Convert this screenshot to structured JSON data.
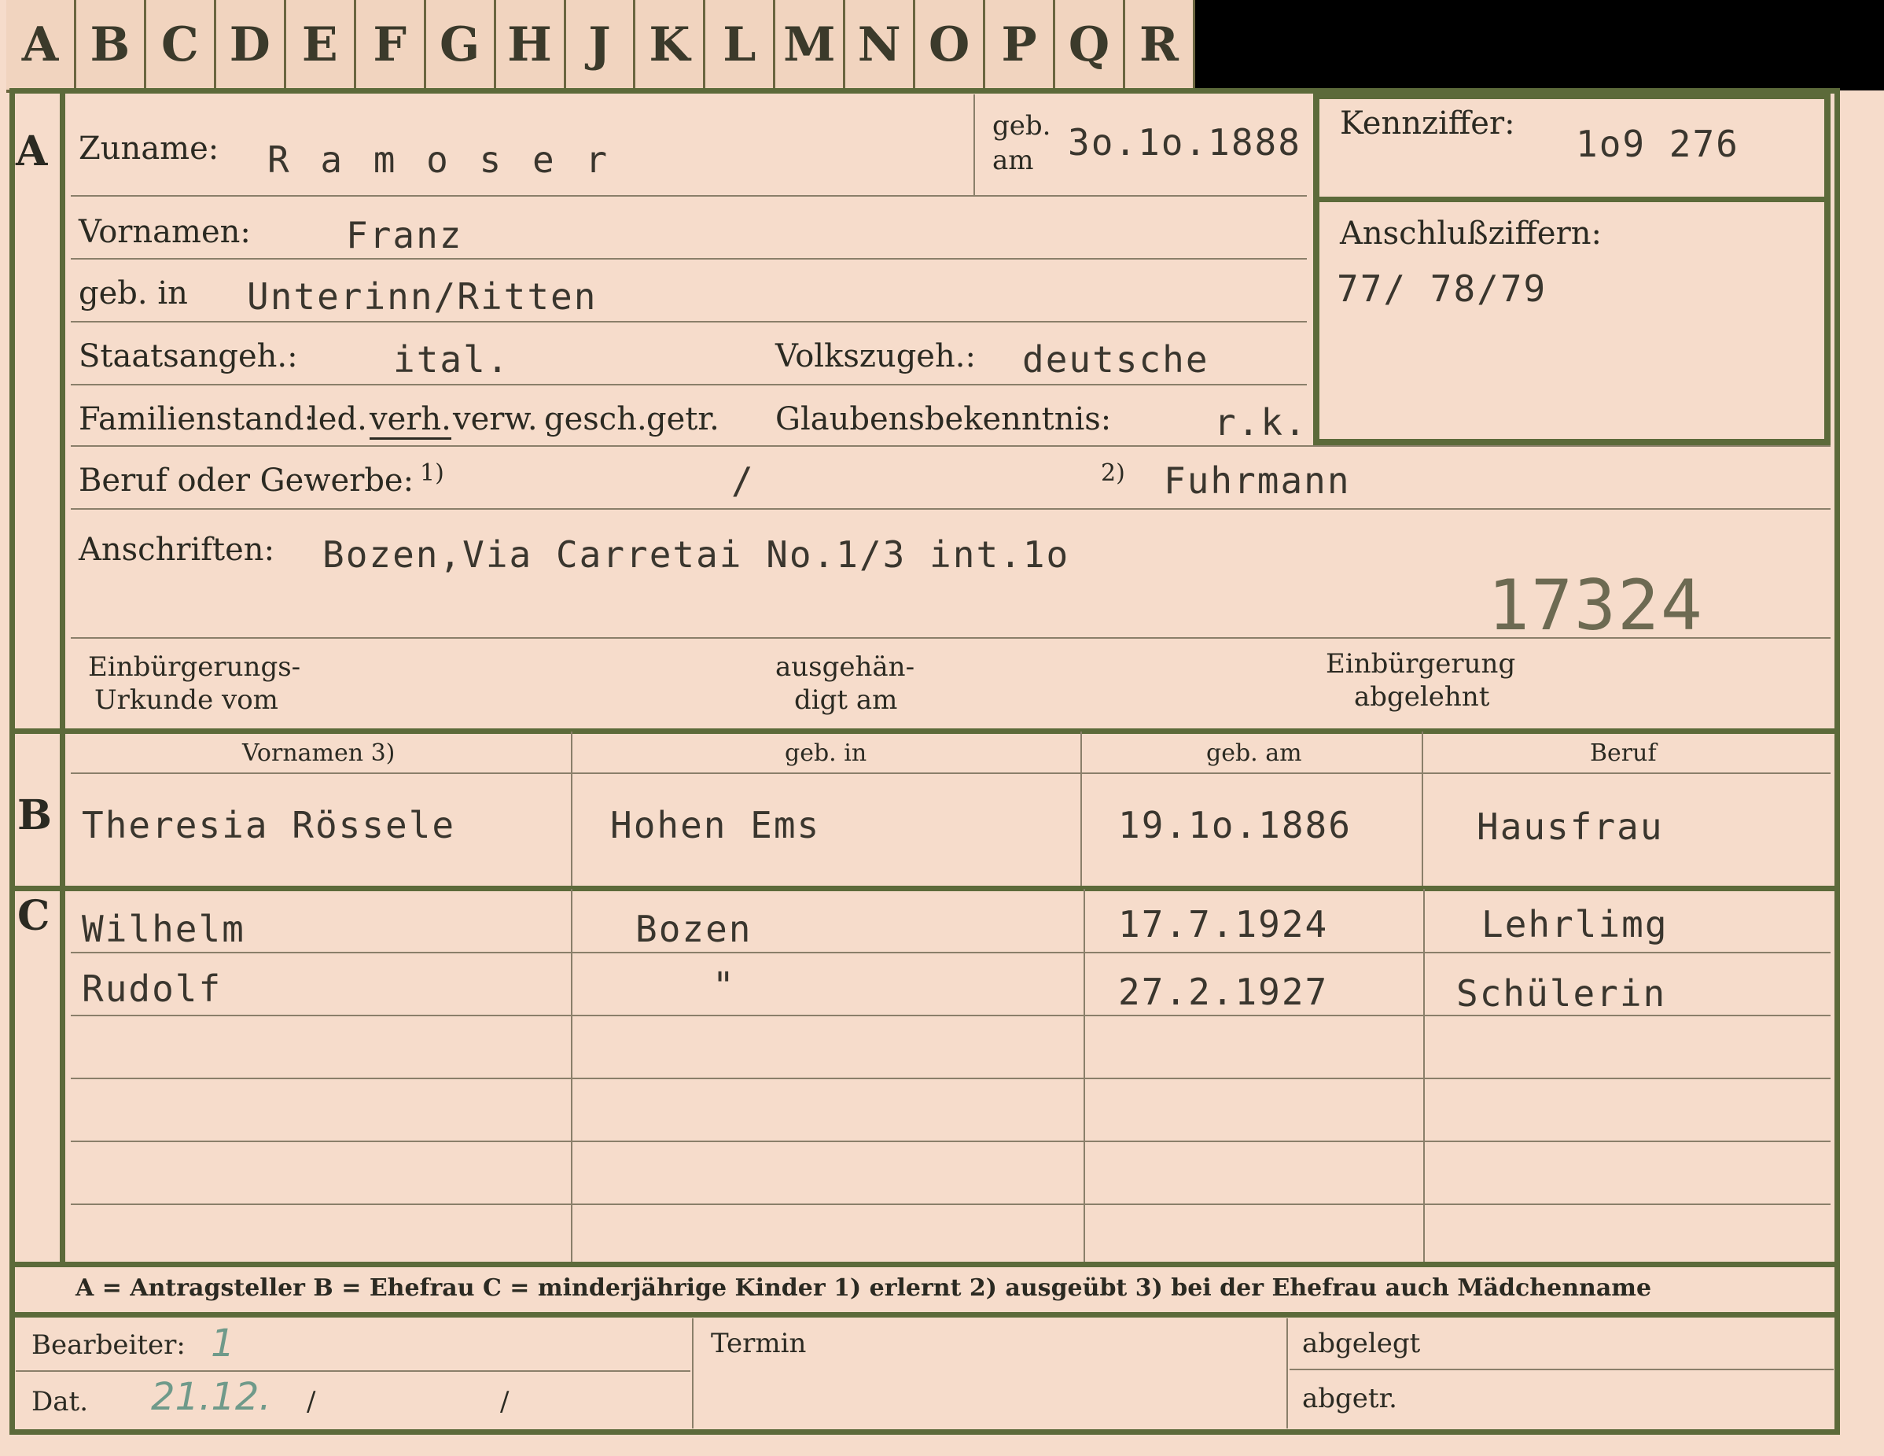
{
  "tabs": [
    "A",
    "B",
    "C",
    "D",
    "E",
    "F",
    "G",
    "H",
    "J",
    "K",
    "L",
    "M",
    "N",
    "O",
    "P",
    "Q",
    "R"
  ],
  "section_letters": {
    "a": "A",
    "b": "B",
    "c": "C"
  },
  "applicant": {
    "surname_label": "Zuname:",
    "surname": "R a m o s e r",
    "born_on_label_1": "geb.",
    "born_on_label_2": "am",
    "born_on": "3o.1o.1888",
    "first_names_label": "Vornamen:",
    "first_names": "Franz",
    "born_in_label": "geb. in",
    "born_in": "Unterinn/Ritten",
    "citizenship_label": "Staatsangeh.:",
    "citizenship": "ital.",
    "ethnicity_label": "Volkszugeh.:",
    "ethnicity": "deutsche",
    "marital_label": "Familienstand:",
    "marital_options": [
      "led.",
      "verh.",
      "verw.",
      "gesch.",
      "getr."
    ],
    "religion_label": "Glaubensbekenntnis:",
    "religion": "r.k.",
    "occupation_label": "Beruf oder Gewerbe:",
    "occupation_note1": "1)",
    "occupation_1": "/",
    "occupation_note2": "2)",
    "occupation_2": "Fuhrmann",
    "address_label": "Anschriften:",
    "address": "Bozen,Via Carretai No.1/3 int.1o",
    "stamp_number": "17324",
    "naturalization_cert_label_1": "Einbürgerungs-",
    "naturalization_cert_label_2": "Urkunde vom",
    "handed_over_label_1": "ausgehän-",
    "handed_over_label_2": "digt am",
    "naturalization_refused_label_1": "Einbürgerung",
    "naturalization_refused_label_2": "abgelehnt"
  },
  "reference": {
    "id_label": "Kennziffer:",
    "id_value": "1o9 276",
    "linked_label": "Anschlußziffern:",
    "linked_value": "77/ 78/79"
  },
  "spouse": {
    "headers": [
      "Vornamen 3)",
      "geb. in",
      "geb. am",
      "Beruf"
    ],
    "row": [
      "Theresia Rössele",
      "Hohen Ems",
      "19.1o.1886",
      "Hausfrau"
    ]
  },
  "children": {
    "rows": [
      [
        "Wilhelm",
        "Bozen",
        "17.7.1924",
        "Lehrlimg"
      ],
      [
        "Rudolf",
        "\"",
        "27.2.1927",
        "Schülerin"
      ]
    ]
  },
  "legend": "A = Antragsteller   B = Ehefrau   C = minderjährige Kinder   1) erlernt   2) ausgeübt   3) bei der Ehefrau auch Mädchenname",
  "footer": {
    "clerk_label": "Bearbeiter:",
    "clerk_mark": "1",
    "date_label": "Dat.",
    "date_value": "21.12.",
    "date_sep1": "/",
    "date_sep2": "/",
    "deadline_label": "Termin",
    "filed_label": "abgelegt",
    "removed_label": "abgetr."
  }
}
